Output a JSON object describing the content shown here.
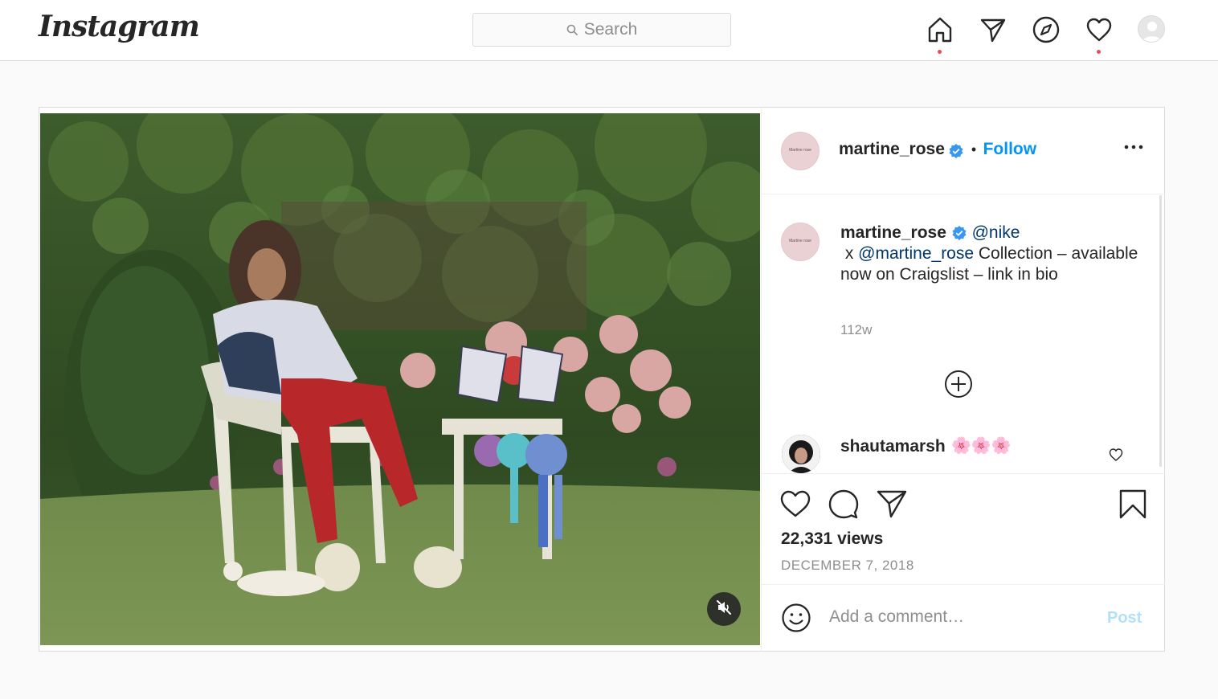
{
  "nav": {
    "logo": "Instagram",
    "search_placeholder": "Search",
    "icons": [
      "home-icon",
      "direct-icon",
      "explore-icon",
      "activity-icon",
      "profile-avatar"
    ]
  },
  "post": {
    "author": "martine_rose",
    "avatar_text": "Martine rose",
    "follow_label": "Follow",
    "separator": "•",
    "caption": {
      "author": "martine_rose",
      "mention_1": "@nike",
      "text_1": " x ",
      "mention_2": "@martine_rose",
      "text_2": " Collection – available now on Craigslist – link in bio"
    },
    "caption_time": "112w",
    "comments": [
      {
        "user": "shautamarsh",
        "text": "🌸🌸🌸"
      }
    ],
    "views": "22,331 views",
    "date": "DECEMBER 7, 2018",
    "comment_placeholder": "Add a comment…",
    "post_label": "Post"
  },
  "colors": {
    "accent": "#0095f6",
    "notification": "#ed4956",
    "border": "#dbdbdb",
    "muted_text": "#8e8e8e",
    "post_disabled": "#b2dffc"
  }
}
